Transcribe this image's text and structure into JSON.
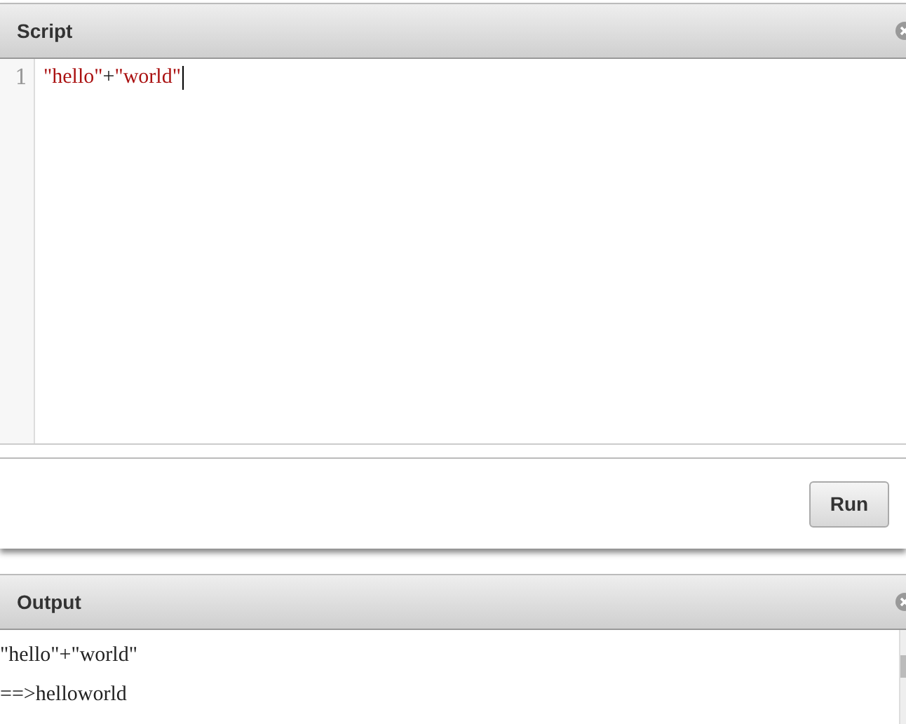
{
  "script_panel": {
    "title": "Script",
    "closable": true,
    "lines": [
      {
        "number": "1",
        "tokens": [
          {
            "kind": "string",
            "text": "\"hello\""
          },
          {
            "kind": "operator",
            "text": "+"
          },
          {
            "kind": "string",
            "text": "\"world\""
          }
        ],
        "cursor": true
      }
    ],
    "run_button": "Run"
  },
  "output_panel": {
    "title": "Output",
    "closable": true,
    "lines": [
      "\"hello\"+\"world\"",
      "==>helloworld"
    ]
  }
}
